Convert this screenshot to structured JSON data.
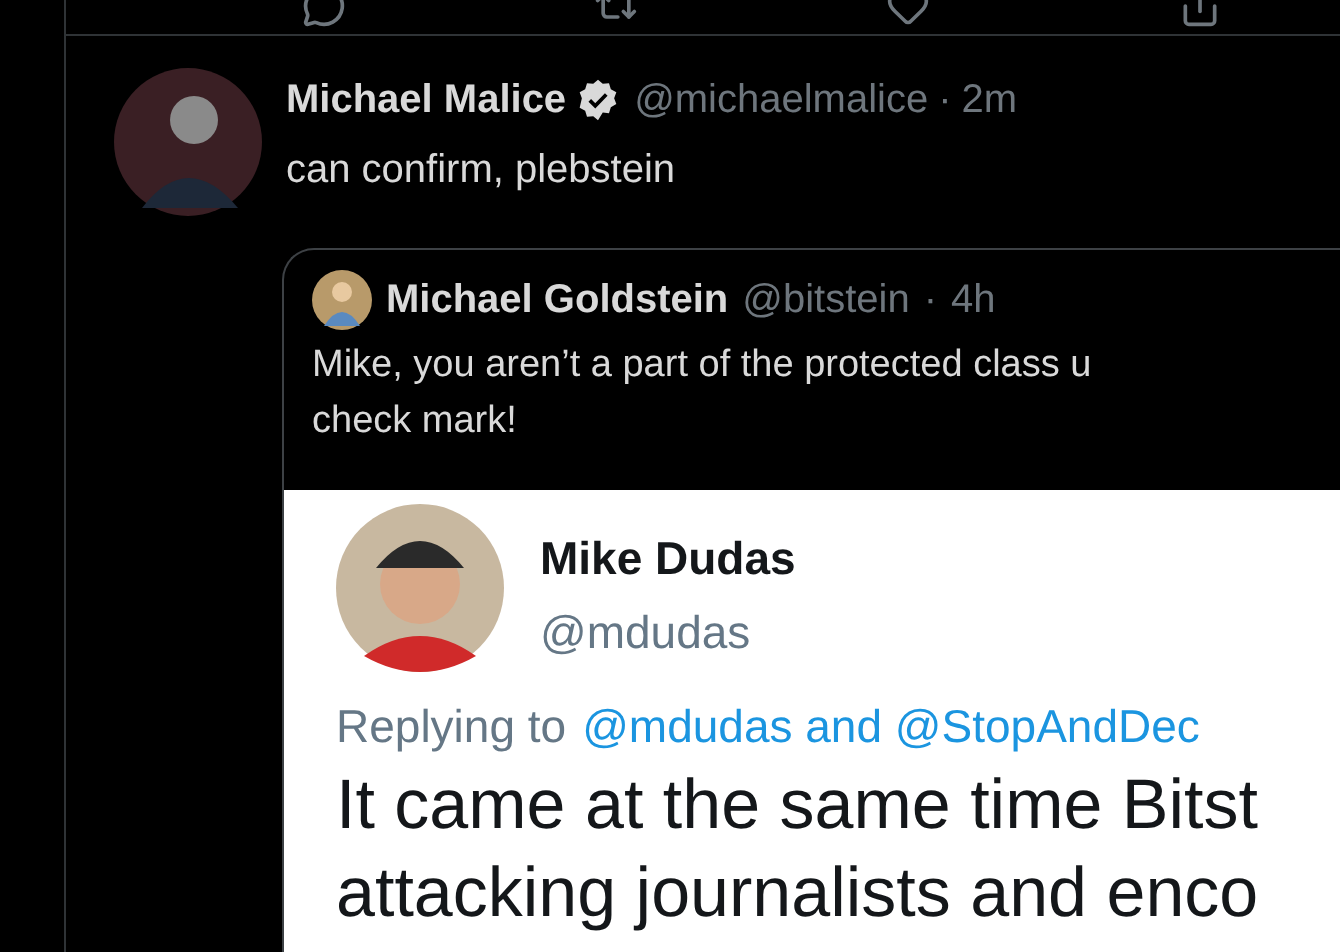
{
  "previous_tweet": {
    "actions": [
      {
        "kind": "reply"
      },
      {
        "kind": "retweet"
      },
      {
        "kind": "like"
      },
      {
        "kind": "share"
      }
    ]
  },
  "tweet": {
    "name": "Michael Malice",
    "verified": true,
    "handle": "@michaelmalice",
    "separator": "·",
    "time": "2m",
    "text": "can confirm, plebstein",
    "quote": {
      "name": "Michael Goldstein",
      "handle": "@bitstein",
      "separator": "·",
      "time": "4h",
      "text": "Mike, you aren’t a part of the protected class u\ncheck mark!",
      "embedded": {
        "name": "Mike Dudas",
        "handle": "@mdudas",
        "replying_label": "Replying to",
        "replying_to": "@mdudas and @StopAndDec",
        "lines": [
          "It came at the same time Bitst",
          "attacking journalists and enco"
        ]
      }
    }
  }
}
